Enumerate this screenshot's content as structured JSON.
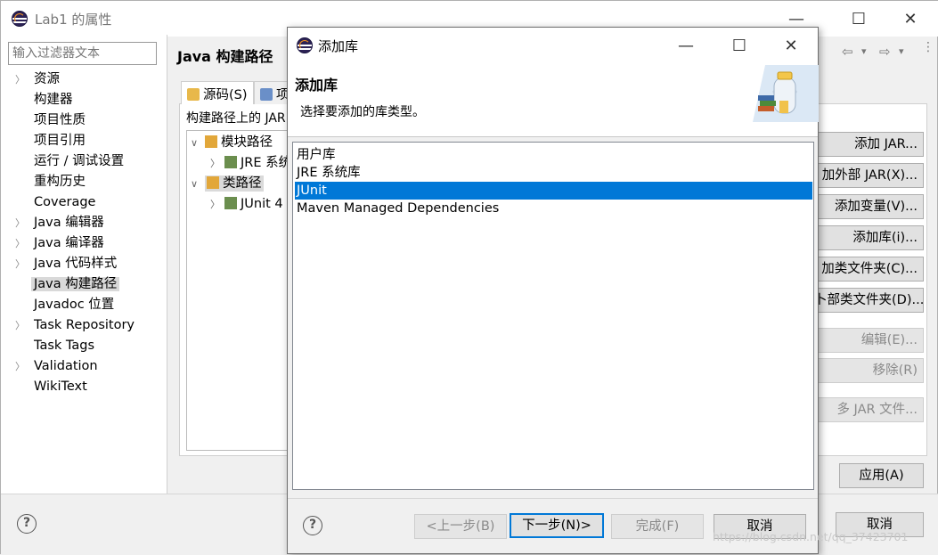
{
  "outer_window": {
    "title": "Lab1 的属性",
    "controls": {
      "minimize": "—",
      "maximize": "☐",
      "close": "✕"
    }
  },
  "filter": {
    "placeholder": "输入过滤器文本"
  },
  "sidebar": {
    "items": [
      {
        "label": "资源",
        "expandable": true
      },
      {
        "label": "构建器",
        "expandable": false
      },
      {
        "label": "项目性质",
        "expandable": false
      },
      {
        "label": "项目引用",
        "expandable": false
      },
      {
        "label": "运行 / 调试设置",
        "expandable": false
      },
      {
        "label": "重构历史",
        "expandable": false
      },
      {
        "label": "Coverage",
        "expandable": false
      },
      {
        "label": "Java 编辑器",
        "expandable": true
      },
      {
        "label": "Java 编译器",
        "expandable": true
      },
      {
        "label": "Java 代码样式",
        "expandable": true
      },
      {
        "label": "Java 构建路径",
        "expandable": false,
        "selected": true
      },
      {
        "label": "Javadoc 位置",
        "expandable": false
      },
      {
        "label": "Task Repository",
        "expandable": true
      },
      {
        "label": "Task Tags",
        "expandable": false
      },
      {
        "label": "Validation",
        "expandable": true
      },
      {
        "label": "WikiText",
        "expandable": false
      }
    ]
  },
  "page": {
    "title": "Java 构建路径",
    "nav": {
      "back": "⇦",
      "forward": "⇨",
      "dropdown": "▾"
    },
    "tabs": [
      {
        "label": "源码(S)",
        "icon": "source-folder-icon"
      },
      {
        "label": "项",
        "icon": "folder-icon"
      }
    ],
    "build_path_label": "构建路径上的 JAR",
    "tree": [
      {
        "label": "模块路径",
        "level": 0,
        "expanded": true
      },
      {
        "label": "JRE 系统",
        "level": 1,
        "expanded": false
      },
      {
        "label": "类路径",
        "level": 0,
        "expanded": true,
        "selected": true
      },
      {
        "label": "JUnit 4",
        "level": 1,
        "expanded": false
      }
    ],
    "side_buttons": [
      {
        "label": "添加 JAR...",
        "enabled": true
      },
      {
        "label": "加外部 JAR(X)...",
        "enabled": true
      },
      {
        "label": "添加变量(V)...",
        "enabled": true
      },
      {
        "label": "添加库(i)...",
        "enabled": true
      },
      {
        "label": "加类文件夹(C)...",
        "enabled": true
      },
      {
        "label": "卜部类文件夹(D)...",
        "enabled": true
      },
      {
        "label": "编辑(E)...",
        "enabled": false
      },
      {
        "label": "移除(R)",
        "enabled": false
      },
      {
        "label": "多 JAR 文件...",
        "enabled": false
      }
    ],
    "apply_label": "应用(A)"
  },
  "outer_footer": {
    "help": "?",
    "cancel_label": "取消"
  },
  "dialog": {
    "title": "添加库",
    "controls": {
      "minimize": "—",
      "maximize": "☐",
      "close": "✕"
    },
    "header_title": "添加库",
    "header_description": "选择要添加的库类型。",
    "libraries": [
      {
        "label": "用户库",
        "selected": false
      },
      {
        "label": "JRE 系统库",
        "selected": false
      },
      {
        "label": "JUnit",
        "selected": true
      },
      {
        "label": "Maven Managed Dependencies",
        "selected": false
      }
    ],
    "footer": {
      "help": "?",
      "back_label": "<上一步(B)",
      "next_label": "下一步(N)>",
      "finish_label": "完成(F)",
      "cancel_label": "取消"
    }
  },
  "watermark": "https://blog.csdn.net/qq_37423701",
  "colors": {
    "selection": "#0078d7",
    "disabled_text": "#8a8a8a"
  }
}
